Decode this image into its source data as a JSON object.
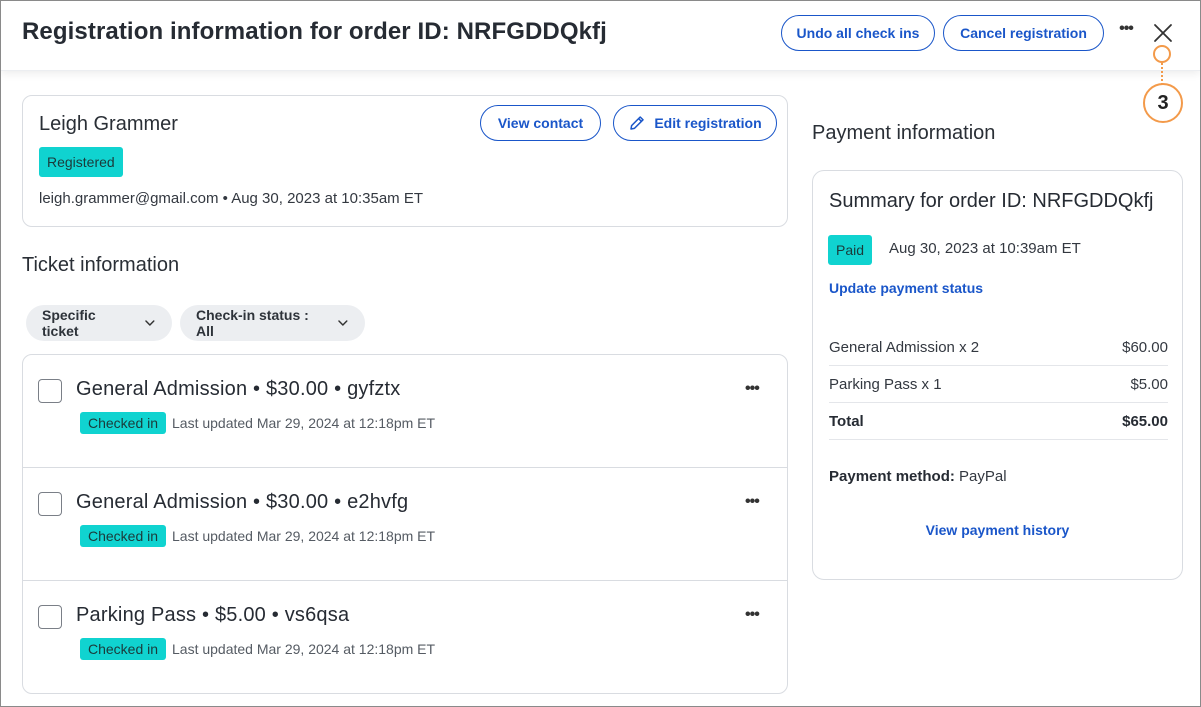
{
  "header": {
    "title": "Registration information for order ID: NRFGDDQkfj",
    "undo_label": "Undo all check ins",
    "cancel_label": "Cancel registration",
    "more_label": "•••"
  },
  "callout": {
    "number": "3"
  },
  "contact": {
    "name": "Leigh Grammer",
    "status": "Registered",
    "meta": "leigh.grammer@gmail.com • Aug 30, 2023 at 10:35am ET",
    "view_contact_label": "View contact",
    "edit_registration_label": "Edit registration"
  },
  "tickets": {
    "title": "Ticket information",
    "filters": {
      "specific": "Specific ticket",
      "checkin": "Check-in status : All"
    },
    "rows": [
      {
        "name": "General Admission • $30.00 • gyfztx",
        "status": "Checked in",
        "updated": "Last updated Mar 29, 2024 at 12:18pm ET"
      },
      {
        "name": "General Admission • $30.00 • e2hvfg",
        "status": "Checked in",
        "updated": "Last updated Mar 29, 2024 at 12:18pm ET"
      },
      {
        "name": "Parking Pass • $5.00 • vs6qsa",
        "status": "Checked in",
        "updated": "Last updated Mar 29, 2024 at 12:18pm ET"
      }
    ],
    "row_more_label": "•••"
  },
  "payment": {
    "title": "Payment information",
    "summary": "Summary for order ID: NRFGDDQkfj",
    "status": "Paid",
    "paid_date": "Aug 30, 2023 at 10:39am ET",
    "update_link": "Update payment status",
    "lines": [
      {
        "label": "General Admission x 2",
        "amount": "$60.00"
      },
      {
        "label": "Parking Pass x 1",
        "amount": "$5.00"
      },
      {
        "label": "Total",
        "amount": "$65.00"
      }
    ],
    "method_label": "Payment method:",
    "method_value": "PayPal",
    "history_link": "View payment history"
  },
  "colors": {
    "accent": "#1a56c9",
    "badge": "#10d3d0",
    "callout": "#f39a4a"
  }
}
